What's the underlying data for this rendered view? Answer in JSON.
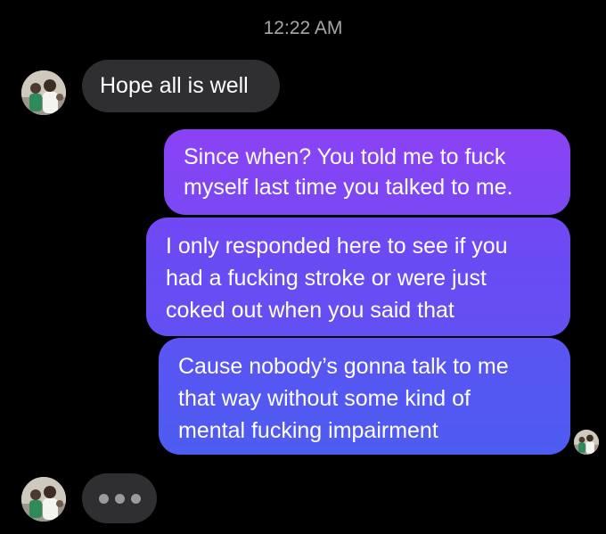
{
  "header": {
    "timestamp": "12:22 AM"
  },
  "colors": {
    "background": "#000000",
    "incoming_bubble": "#2f2f31",
    "outgoing_gradient_top": "#8b42f5",
    "outgoing_gradient_bottom": "#4d5cf1",
    "timestamp_text": "#a7a7ab"
  },
  "thread": {
    "contact_avatar_icon": "contact-photo-avatar",
    "incoming_1": {
      "lines": [
        "Hope all is well"
      ]
    },
    "outgoing_1": {
      "lines": [
        "Since when? You told me to fuck",
        "myself last time you talked to me."
      ]
    },
    "outgoing_2": {
      "lines": [
        "I only responded here to see if you",
        "had a fucking stroke or were just",
        "coked out when you said that"
      ]
    },
    "outgoing_3": {
      "lines": [
        "Cause nobody’s gonna talk to me",
        "that way without some kind of",
        "mental fucking impairment"
      ]
    },
    "typing_indicator": {
      "icon": "ellipsis-dots-icon"
    }
  }
}
